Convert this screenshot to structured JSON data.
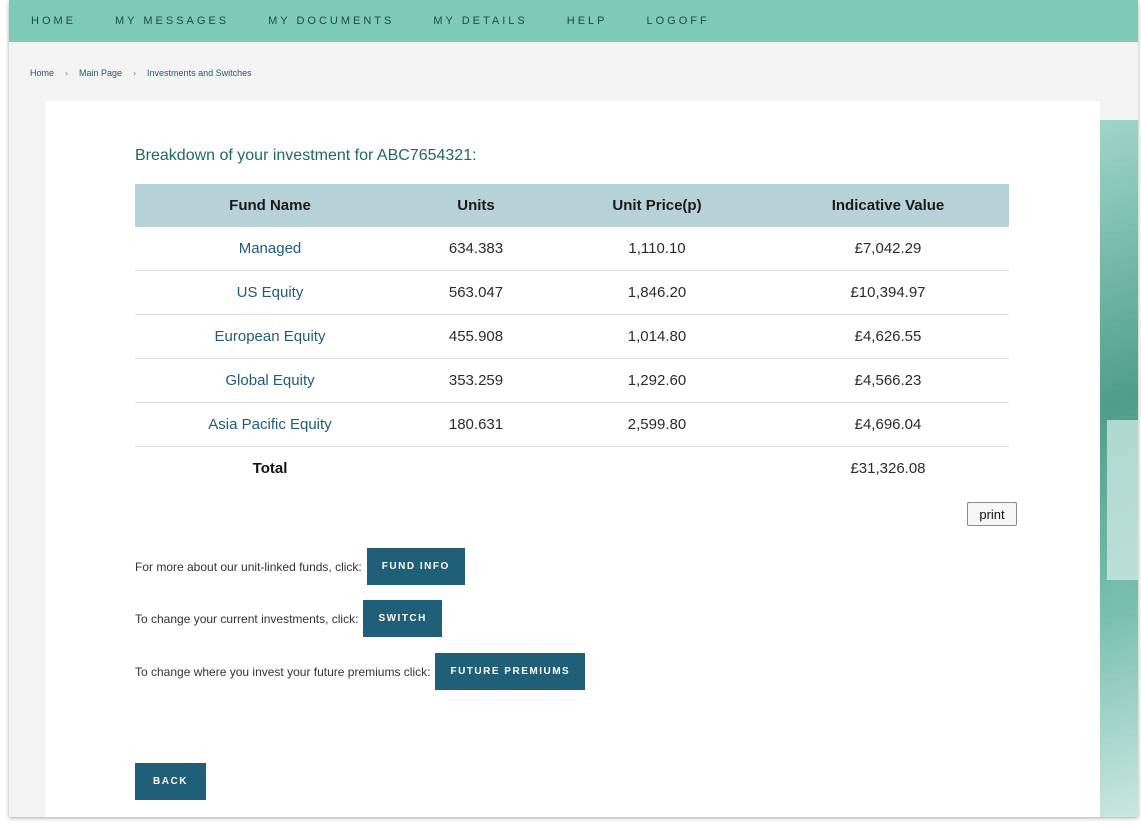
{
  "nav": {
    "items": [
      "HOME",
      "MY MESSAGES",
      "MY DOCUMENTS",
      "MY DETAILS",
      "HELP",
      "LOGOFF"
    ]
  },
  "breadcrumb": {
    "items": [
      "Home",
      "Main Page",
      "Investments and Switches"
    ],
    "separator": "›"
  },
  "page": {
    "heading": "Breakdown of your investment for ABC7654321:"
  },
  "table": {
    "headers": [
      "Fund Name",
      "Units",
      "Unit Price(p)",
      "Indicative Value"
    ],
    "rows": [
      {
        "name": "Managed",
        "units": "634.383",
        "price": "1,110.10",
        "value": "£7,042.29"
      },
      {
        "name": "US Equity",
        "units": "563.047",
        "price": "1,846.20",
        "value": "£10,394.97"
      },
      {
        "name": "European Equity",
        "units": "455.908",
        "price": "1,014.80",
        "value": "£4,626.55"
      },
      {
        "name": "Global Equity",
        "units": "353.259",
        "price": "1,292.60",
        "value": "£4,566.23"
      },
      {
        "name": "Asia Pacific Equity",
        "units": "180.631",
        "price": "2,599.80",
        "value": "£4,696.04"
      }
    ],
    "total": {
      "label": "Total",
      "value": "£31,326.08"
    }
  },
  "print_label": "print",
  "actions": {
    "fund_info": {
      "text": "For more about our unit-linked funds, click:",
      "button": "FUND INFO"
    },
    "switch": {
      "text": "To change your current investments, click:",
      "button": "SWITCH"
    },
    "future_premiums": {
      "text": "To change where you invest your future premiums click:",
      "button": "FUTURE PREMIUMS"
    }
  },
  "back_label": "BACK",
  "colors": {
    "nav_bg": "#7fc9b7",
    "button_bg": "#1f5f78",
    "table_header_bg": "#b7d1d8",
    "heading": "#1f6a5a"
  }
}
